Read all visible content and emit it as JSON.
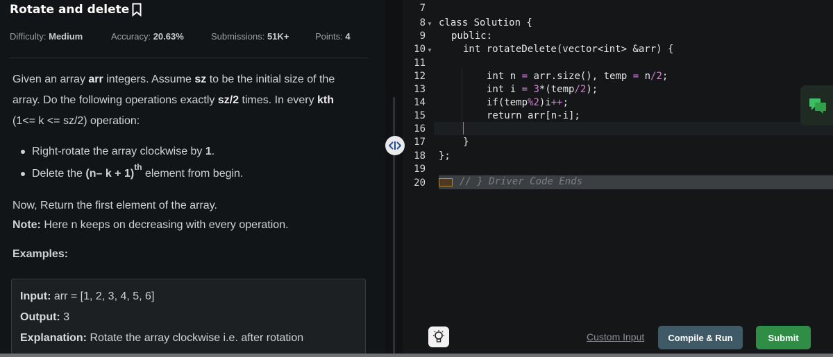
{
  "problem": {
    "title": "Rotate and delete",
    "difficulty_label": "Difficulty:",
    "difficulty": "Medium",
    "accuracy_label": "Accuracy:",
    "accuracy": "20.63%",
    "submissions_label": "Submissions:",
    "submissions": "51K+",
    "points_label": "Points:",
    "points": "4",
    "desc_1a": "Given an array ",
    "desc_1b": "arr",
    "desc_1c": " integers. Assume ",
    "desc_1d": "sz",
    "desc_1e": " to be the initial size of the",
    "desc_2a": "array. Do the following operations exactly ",
    "desc_2b": "sz/2",
    "desc_2c": " times. In every ",
    "desc_2d": "kth",
    "desc_3": "(1<= k <= sz/2) operation:",
    "bullet_1a": "Right-rotate the array clockwise by ",
    "bullet_1b": "1",
    "bullet_1c": ".",
    "bullet_2a": "Delete the ",
    "bullet_2b": "(n– k + 1)",
    "bullet_2sup": "th",
    "bullet_2c": " element from begin.",
    "return_text": "Now, Return the first element of the array.",
    "note_label": "Note:",
    "note_text": " Here n keeps on decreasing with every operation.",
    "examples_label": "Examples:",
    "example": {
      "input_label": "Input:",
      "input_text": " arr = [1, 2, 3, 4, 5, 6]",
      "output_label": "Output:",
      "output_text": " 3",
      "explanation_label": "Explanation:",
      "explanation_text": " Rotate the array clockwise i.e. after rotation"
    }
  },
  "editor": {
    "line_numbers": [
      "7",
      "8",
      "9",
      "10",
      "11",
      "12",
      "13",
      "14",
      "15",
      "16",
      "17",
      "18",
      "19",
      "20"
    ],
    "code": {
      "l8_a": "class Solution {",
      "l9": "public:",
      "l10": "int rotateDelete(vector<int> &arr) {",
      "l12_a": "int n ",
      "l12_op": "=",
      "l12_b": " arr.size(), temp ",
      "l12_op2": "=",
      "l12_c": " n",
      "l12_op3": "/",
      "l12_num": "2",
      "l12_d": ";",
      "l13_a": "int i ",
      "l13_op": "=",
      "l13_b": " ",
      "l13_num": "3",
      "l13_c": "*(temp",
      "l13_op2": "/",
      "l13_num2": "2",
      "l13_d": ");",
      "l14_a": "if(temp",
      "l14_op": "%",
      "l14_num": "2",
      "l14_b": ")i",
      "l14_op2": "++",
      "l14_c": ";",
      "l15": "return arr[n-i];",
      "l17": "}",
      "l18": "};",
      "l20": "// } Driver Code Ends"
    }
  },
  "bottom": {
    "custom_input": "Custom Input",
    "compile_run": "Compile & Run",
    "submit": "Submit"
  },
  "icons": {
    "bookmark": "bookmark-icon",
    "resize": "resize-handle-icon",
    "chat": "chat-icon",
    "bulb": "lightbulb-icon"
  },
  "colors": {
    "submit": "#2f8d46",
    "compile": "#3f5a66",
    "operator": "#cc7fd8"
  }
}
